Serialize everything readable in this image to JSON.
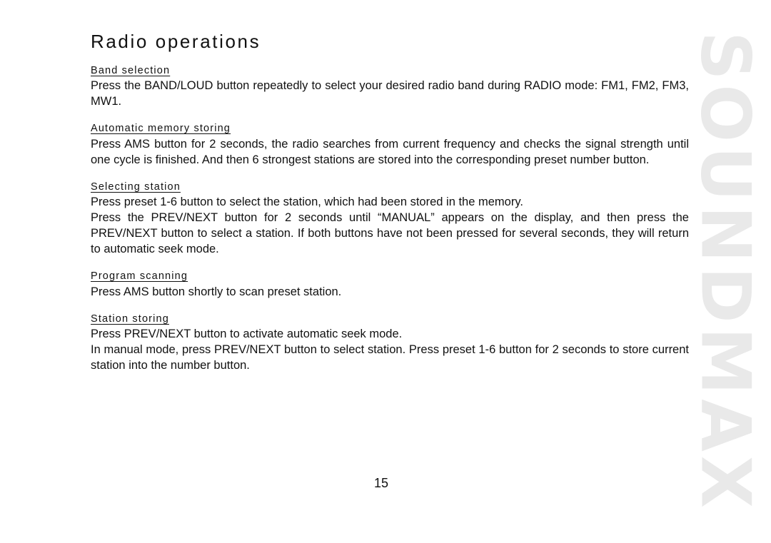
{
  "document": {
    "title": "Radio operations",
    "page_number": "15",
    "watermark": "SOUNDMAX",
    "watermark_color": "#e9e9e9",
    "text_color": "#111111",
    "background_color": "#ffffff"
  },
  "sections": [
    {
      "heading": "Band selection",
      "paragraphs": [
        "Press the BAND/LOUD button repeatedly to select your desired radio band during RADIO mode: FM1, FM2, FM3, MW1."
      ]
    },
    {
      "heading": "Automatic memory storing",
      "paragraphs": [
        "Press AMS button for 2 seconds, the radio searches from current frequency and checks the signal strength until one cycle is finished. And then 6 strongest stations are stored into the corresponding preset number button."
      ]
    },
    {
      "heading": "Selecting station",
      "paragraphs": [
        "Press preset 1-6 button to select the station, which had been stored in the memory.",
        "Press the PREV/NEXT button for 2 seconds until “MANUAL” appears on the display, and then press the PREV/NEXT button to select a station. If both buttons have not been pressed for several seconds, they will return to automatic seek mode."
      ]
    },
    {
      "heading": "Program scanning",
      "paragraphs": [
        "Press AMS button shortly to scan preset station."
      ]
    },
    {
      "heading": "Station storing",
      "paragraphs": [
        "Press PREV/NEXT button to activate automatic seek mode.",
        "In manual mode, press PREV/NEXT button to select station. Press preset 1-6 button for 2 seconds to store current station into the number button."
      ]
    }
  ]
}
